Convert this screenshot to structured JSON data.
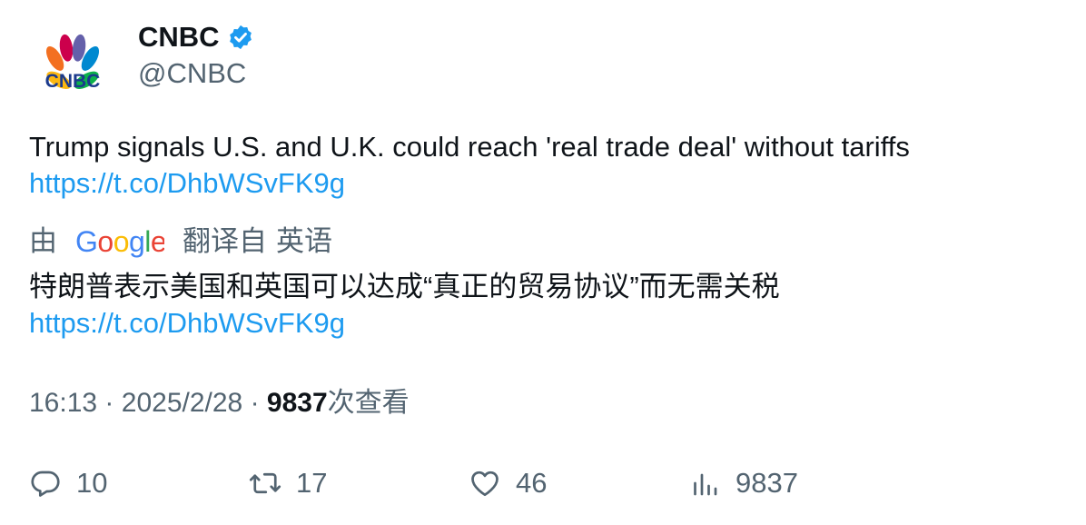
{
  "account": {
    "name": "CNBC",
    "handle": "@CNBC",
    "verified": true,
    "logo_text": "CNBC",
    "avatar_icon": "nbc-peacock-icon"
  },
  "tweet": {
    "text": "Trump signals U.S. and U.K. could reach 'real trade deal' without tariffs",
    "link": "https://t.co/DhbWSvFK9g"
  },
  "translation": {
    "prefix": "由",
    "provider": "Google",
    "label": "翻译自",
    "language": "英语",
    "text": "特朗普表示美国和英国可以达成“真正的贸易协议”而无需关税",
    "link": "https://t.co/DhbWSvFK9g"
  },
  "meta": {
    "time": "16:13",
    "sep1": "·",
    "date": "2025/2/28",
    "sep2": "·",
    "views": "9837",
    "views_label": "次查看"
  },
  "actions": {
    "replies": "10",
    "retweets": "17",
    "likes": "46",
    "views": "9837"
  },
  "colors": {
    "link": "#1d9bf0",
    "secondary": "#536471",
    "text": "#0f1419",
    "verified": "#1d9bf0"
  }
}
